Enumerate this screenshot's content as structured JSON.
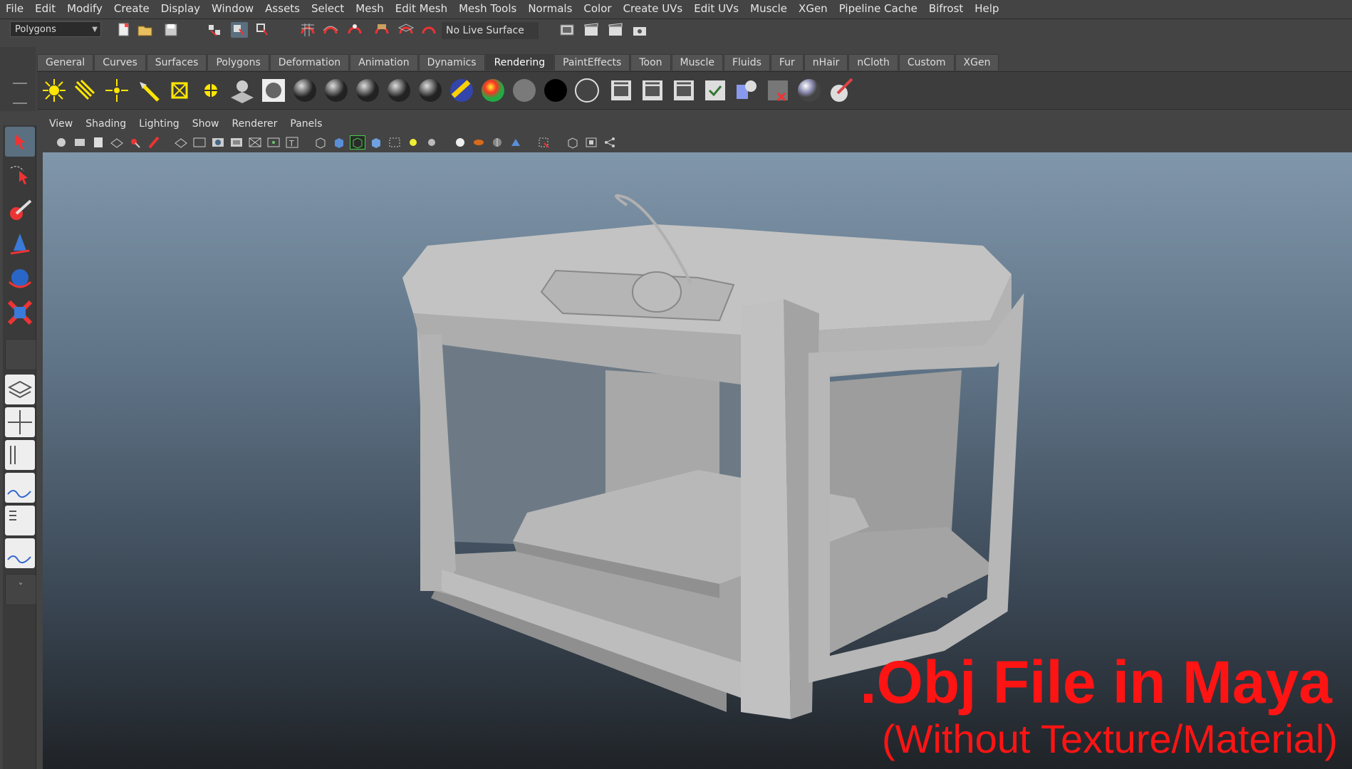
{
  "menubar": {
    "items": [
      "File",
      "Edit",
      "Modify",
      "Create",
      "Display",
      "Window",
      "Assets",
      "Select",
      "Mesh",
      "Edit Mesh",
      "Mesh Tools",
      "Normals",
      "Color",
      "Create UVs",
      "Edit UVs",
      "Muscle",
      "XGen",
      "Pipeline Cache",
      "Bifrost",
      "Help"
    ]
  },
  "statusline": {
    "mode_select": "Polygons",
    "live_surface": "No Live Surface"
  },
  "shelf": {
    "tabs": [
      "General",
      "Curves",
      "Surfaces",
      "Polygons",
      "Deformation",
      "Animation",
      "Dynamics",
      "Rendering",
      "PaintEffects",
      "Toon",
      "Muscle",
      "Fluids",
      "Fur",
      "nHair",
      "nCloth",
      "Custom",
      "XGen"
    ],
    "active_tab": "Rendering",
    "icons": [
      "ambient-light-icon",
      "directional-light-icon",
      "point-light-icon",
      "spot-light-icon",
      "area-light-icon",
      "volume-light-icon",
      "ibl-icon",
      "hypershade-sphere-icon",
      "lambert-icon",
      "blinn-icon",
      "phong-icon",
      "anisotropic-icon",
      "ramp-shader-icon",
      "use-background-icon",
      "surface-shader-icon",
      "layered-shader-icon",
      "render-current-frame-icon",
      "ipr-render-icon",
      "batch-render-icon",
      "render-settings-icon",
      "hypershade-icon",
      "render-view-icon",
      "shading-group-icon",
      "paint-render-icon"
    ]
  },
  "panel": {
    "menus": [
      "View",
      "Shading",
      "Lighting",
      "Show",
      "Renderer",
      "Panels"
    ]
  },
  "overlay": {
    "title": ".Obj File in Maya",
    "subtitle": "(Without Texture/Material)"
  },
  "colors": {
    "accent_red": "#ff1414",
    "ui_bg": "#444444",
    "viewport_top": "#8096aa",
    "viewport_bottom": "#1f2327"
  }
}
